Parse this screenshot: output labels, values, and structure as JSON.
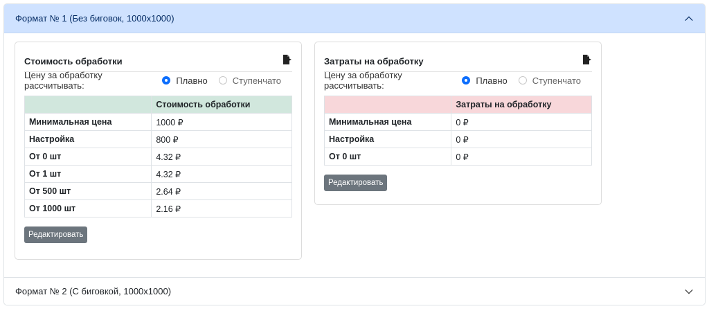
{
  "accordion": {
    "section1": {
      "title": "Формат № 1 (Без биговок, 1000x1000)",
      "expanded": true
    },
    "section2": {
      "title": "Формат № 2 (С биговкой, 1000x1000)",
      "expanded": false
    }
  },
  "cost_card": {
    "title": "Стоимость обработки",
    "calc_label": "Цену за обработку рассчитывать:",
    "option_smooth": "Плавно",
    "option_stepped": "Ступенчато",
    "selected": "smooth",
    "column_header": "Стоимость обработки",
    "rows": [
      {
        "label": "Минимальная цена",
        "value": "1000 ₽"
      },
      {
        "label": "Настройка",
        "value": "800 ₽"
      },
      {
        "label": "От 0 шт",
        "value": "4.32 ₽"
      },
      {
        "label": "От 1 шт",
        "value": "4.32 ₽"
      },
      {
        "label": "От 500 шт",
        "value": "2.64 ₽"
      },
      {
        "label": "От 1000 шт",
        "value": "2.16 ₽"
      }
    ],
    "edit_button": "Редактировать",
    "header_color": "#d1e7dd"
  },
  "expense_card": {
    "title": "Затраты на обработку",
    "calc_label": "Цену за обработку рассчитывать:",
    "option_smooth": "Плавно",
    "option_stepped": "Ступенчато",
    "selected": "smooth",
    "column_header": "Затраты на обработку",
    "rows": [
      {
        "label": "Минимальная цена",
        "value": "0 ₽"
      },
      {
        "label": "Настройка",
        "value": "0 ₽"
      },
      {
        "label": "От 0 шт",
        "value": "0 ₽"
      }
    ],
    "edit_button": "Редактировать",
    "header_color": "#f8d7da"
  },
  "icons": {
    "export": "export-icon",
    "chevron_up": "chevron-up-icon",
    "chevron_down": "chevron-down-icon"
  },
  "colors": {
    "accent": "#0d6efd",
    "accordion_active": "#cfe2ff",
    "button": "#6c757d"
  }
}
